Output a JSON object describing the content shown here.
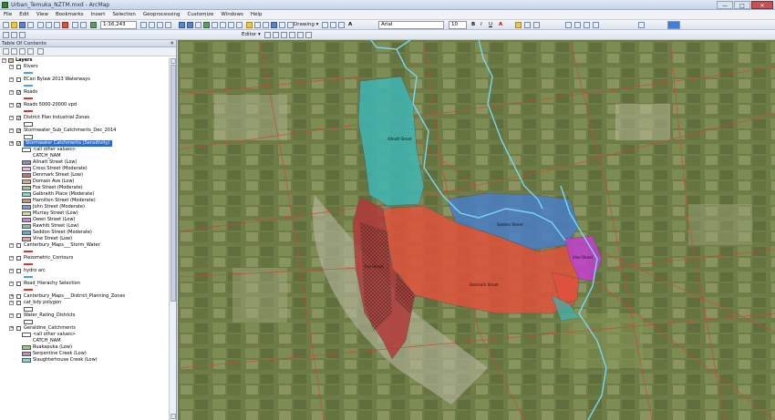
{
  "window": {
    "title": "Urban_Temuka_NZTM.mxd - ArcMap",
    "controls": [
      "—",
      "□",
      "✕"
    ]
  },
  "menu": [
    "File",
    "Edit",
    "View",
    "Bookmarks",
    "Insert",
    "Selection",
    "Geoprocessing",
    "Customize",
    "Windows",
    "Help"
  ],
  "toolbar": {
    "scale": "1:16,243",
    "drawing_label": "Drawing ▾",
    "font_name": "Arial",
    "font_size": "10",
    "bold": "B",
    "italic": "I",
    "underline": "U",
    "font_color": "A",
    "editor_label": "Editor ▾"
  },
  "toc": {
    "title": "Table Of Contents",
    "close": "✕",
    "root": "Layers",
    "layers": [
      {
        "name": "Rivers",
        "checked": false,
        "sym": "line",
        "color": "#4aa3e0"
      },
      {
        "name": "ECan Bylaw 2013 Waterways",
        "checked": false,
        "sym": "line",
        "color": "#4aa3e0"
      },
      {
        "name": "Roads",
        "checked": true,
        "sym": "line",
        "color": "#d33a2c"
      },
      {
        "name": "Roads 5000-20000 vpd",
        "checked": true,
        "sym": "line",
        "color": "#d33a2c"
      },
      {
        "name": "District Plan Industrial Zones",
        "checked": true,
        "sym": "box",
        "color": "#ffffff"
      },
      {
        "name": "Stormwater_Sub_Catchments_Dec_2014",
        "checked": true,
        "sym": "box",
        "color": "#ffffff"
      },
      {
        "name": "Stormwater Catchments (Sensitivity)",
        "checked": true,
        "selected": true
      }
    ],
    "catchments_header": "<all other values>",
    "catchments_field": "CATCH_NAM",
    "catchments": [
      {
        "name": "Allnatt Street (Low)",
        "color": "#8b86d6"
      },
      {
        "name": "Cross Street (Moderate)",
        "color": "#e7b8e8"
      },
      {
        "name": "Denmark Street (Low)",
        "color": "#d56a6a"
      },
      {
        "name": "Domain Ave (Low)",
        "color": "#c8b39a"
      },
      {
        "name": "Fox Street (Moderate)",
        "color": "#9bc78a"
      },
      {
        "name": "Galbraith Place (Moderate)",
        "color": "#8fd3d0"
      },
      {
        "name": "Hamilton Street (Moderate)",
        "color": "#e08c5e"
      },
      {
        "name": "John Street (Moderate)",
        "color": "#7f9ad8"
      },
      {
        "name": "Murray Street (Low)",
        "color": "#d7e07e"
      },
      {
        "name": "Owen Street (Low)",
        "color": "#c58ad6"
      },
      {
        "name": "Rawhiti Street (Low)",
        "color": "#7cc7a3"
      },
      {
        "name": "Seddon Street (Moderate)",
        "color": "#6fa3d8"
      },
      {
        "name": "Vine Street (Low)",
        "color": "#e3a6a6"
      }
    ],
    "more_layers": [
      {
        "name": "Canterbury_Maps___Storm_Water",
        "checked": false,
        "sym": "line",
        "color": "#d33a2c"
      },
      {
        "name": "Piezometric_Contours",
        "checked": false,
        "sym": "line",
        "color": "#d33a2c"
      },
      {
        "name": "hydro arc",
        "checked": false,
        "sym": "line",
        "color": "#4aa3e0"
      },
      {
        "name": "Road_Hierachy Selection",
        "checked": false,
        "sym": "line",
        "color": "#d33a2c"
      },
      {
        "name": "Canterbury_Maps___District_Planning_Zones",
        "checked": false,
        "sym": "none"
      },
      {
        "name": "cat_bdy polygon",
        "checked": false,
        "sym": "box",
        "color": "#ffffff"
      },
      {
        "name": "Water_Rating_Districts",
        "checked": false,
        "sym": "box",
        "color": "#ffffff"
      },
      {
        "name": "Geraldine_Catchments",
        "checked": false
      }
    ],
    "geraldine_header": "<all other values>",
    "geraldine_field": "CATCH_NAM",
    "geraldine": [
      {
        "name": "Ruakapuka (Low)",
        "color": "#9bc78a"
      },
      {
        "name": "Serpentine Creek (Low)",
        "color": "#c58ad6"
      },
      {
        "name": "Slaughterhouse Creek (Low)",
        "color": "#8fd3d0"
      }
    ]
  },
  "map": {
    "labels": [
      "Allnatt Street",
      "Seddon Street",
      "Denmark Street",
      "Fox Street",
      "Vine Street"
    ],
    "colors": {
      "teal": "#3fb6b3",
      "blue": "#4a7fc8",
      "red": "#e0523c",
      "maroon": "#b23a3a",
      "magenta": "#c23fd0",
      "river": "#79d8f2"
    }
  }
}
